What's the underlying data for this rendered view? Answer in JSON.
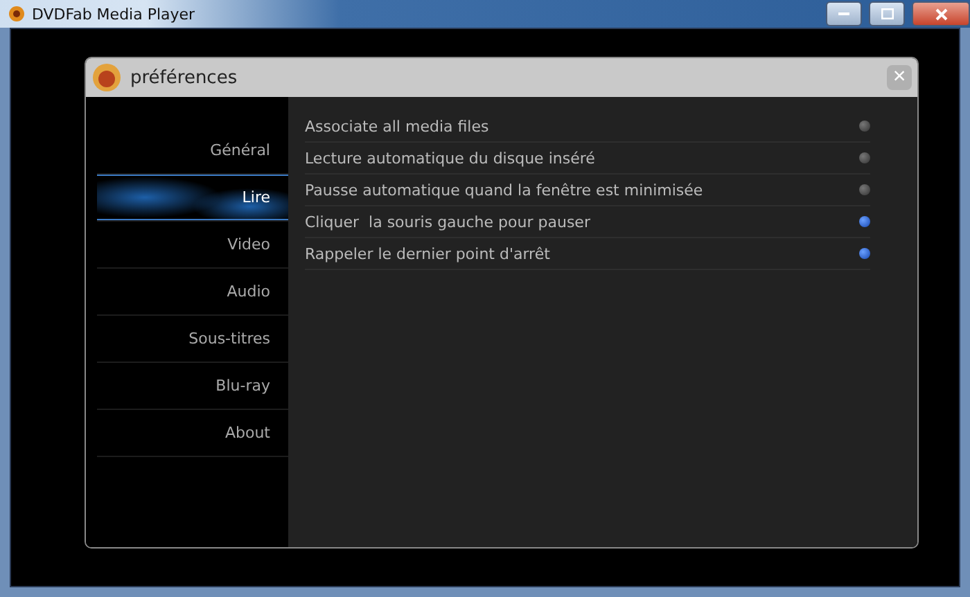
{
  "window": {
    "title": "DVDFab Media Player"
  },
  "dialog": {
    "title": "préférences",
    "close": "×"
  },
  "sidebar": {
    "items": [
      {
        "label": "Général",
        "selected": false
      },
      {
        "label": "Lire",
        "selected": true
      },
      {
        "label": "Video",
        "selected": false
      },
      {
        "label": "Audio",
        "selected": false
      },
      {
        "label": "Sous-titres",
        "selected": false
      },
      {
        "label": "Blu-ray",
        "selected": false
      },
      {
        "label": "About",
        "selected": false
      }
    ]
  },
  "options": [
    {
      "label": "Associate all media files",
      "checked": false
    },
    {
      "label": "Lecture automatique du disque inséré",
      "checked": false
    },
    {
      "label": "Pausse automatique quand la fenêtre est minimisée",
      "checked": false
    },
    {
      "label": "Cliquer  la souris gauche pour pauser",
      "checked": true
    },
    {
      "label": "Rappeler le dernier point d'arrêt",
      "checked": true
    }
  ]
}
